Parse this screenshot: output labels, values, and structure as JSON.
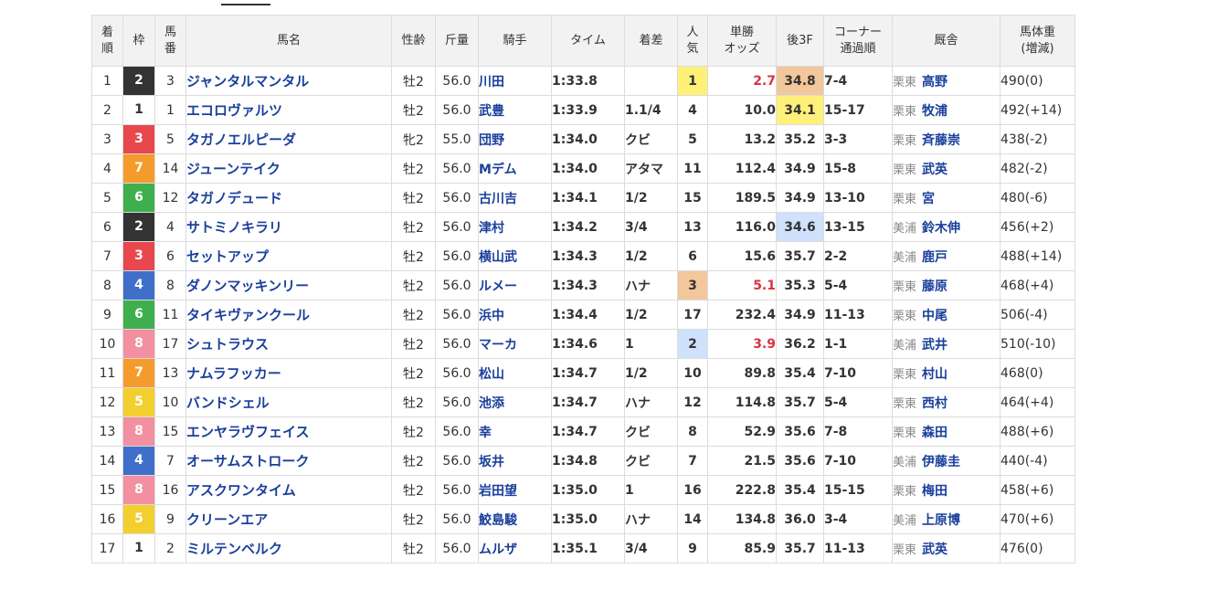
{
  "headers": {
    "rank": "着順",
    "frame": "枠",
    "number": "馬番",
    "horse": "馬名",
    "sexage": "性齢",
    "weight_carried": "斤量",
    "jockey": "騎手",
    "time": "タイム",
    "margin": "着差",
    "popularity": "人気",
    "odds": "単勝オッズ",
    "last3f": "後3F",
    "corner": "コーナー通過順",
    "stable": "厩舎",
    "body_weight": "馬体重(増減)"
  },
  "header_lines": {
    "rank": [
      "着",
      "順"
    ],
    "number": [
      "馬",
      "番"
    ],
    "popularity": [
      "人",
      "気"
    ],
    "odds": [
      "単勝",
      "オッズ"
    ],
    "corner": [
      "コーナー",
      "通過順"
    ],
    "body_weight": [
      "馬体重",
      "(増減)"
    ]
  },
  "frame_colors": {
    "1": {
      "bg": "#ffffff",
      "fg": "#333333"
    },
    "2": {
      "bg": "#333333",
      "fg": "#ffffff"
    },
    "3": {
      "bg": "#e8474e",
      "fg": "#ffffff"
    },
    "4": {
      "bg": "#3f6fc9",
      "fg": "#ffffff"
    },
    "5": {
      "bg": "#f2cf2f",
      "fg": "#ffffff"
    },
    "6": {
      "bg": "#3fae4f",
      "fg": "#ffffff"
    },
    "7": {
      "bg": "#f59b2b",
      "fg": "#ffffff"
    },
    "8": {
      "bg": "#f28fa0",
      "fg": "#ffffff"
    }
  },
  "rows": [
    {
      "rank": "1",
      "frame": "2",
      "number": "3",
      "horse": "ジャンタルマンタル",
      "sexage": "牡2",
      "weight_carried": "56.0",
      "jockey": "川田",
      "time": "1:33.8",
      "margin": "",
      "popularity": "1",
      "odds": "2.7",
      "last3f": "34.8",
      "corner": "7-4",
      "area": "栗東",
      "trainer": "高野",
      "body_weight": "490(0)",
      "pop_hl": "yellow",
      "odds_fav": true,
      "last3f_hl": "orange"
    },
    {
      "rank": "2",
      "frame": "1",
      "number": "1",
      "horse": "エコロヴァルツ",
      "sexage": "牡2",
      "weight_carried": "56.0",
      "jockey": "武豊",
      "time": "1:33.9",
      "margin": "1.1/4",
      "popularity": "4",
      "odds": "10.0",
      "last3f": "34.1",
      "corner": "15-17",
      "area": "栗東",
      "trainer": "牧浦",
      "body_weight": "492(+14)",
      "pop_hl": "",
      "odds_fav": false,
      "last3f_hl": "yellow"
    },
    {
      "rank": "3",
      "frame": "3",
      "number": "5",
      "horse": "タガノエルピーダ",
      "sexage": "牝2",
      "weight_carried": "55.0",
      "jockey": "団野",
      "time": "1:34.0",
      "margin": "クビ",
      "popularity": "5",
      "odds": "13.2",
      "last3f": "35.2",
      "corner": "3-3",
      "area": "栗東",
      "trainer": "斉藤崇",
      "body_weight": "438(-2)",
      "pop_hl": "",
      "odds_fav": false,
      "last3f_hl": ""
    },
    {
      "rank": "4",
      "frame": "7",
      "number": "14",
      "horse": "ジューンテイク",
      "sexage": "牡2",
      "weight_carried": "56.0",
      "jockey": "Mデム",
      "time": "1:34.0",
      "margin": "アタマ",
      "popularity": "11",
      "odds": "112.4",
      "last3f": "34.9",
      "corner": "15-8",
      "area": "栗東",
      "trainer": "武英",
      "body_weight": "482(-2)",
      "pop_hl": "",
      "odds_fav": false,
      "last3f_hl": ""
    },
    {
      "rank": "5",
      "frame": "6",
      "number": "12",
      "horse": "タガノデュード",
      "sexage": "牡2",
      "weight_carried": "56.0",
      "jockey": "古川吉",
      "time": "1:34.1",
      "margin": "1/2",
      "popularity": "15",
      "odds": "189.5",
      "last3f": "34.9",
      "corner": "13-10",
      "area": "栗東",
      "trainer": "宮",
      "body_weight": "480(-6)",
      "pop_hl": "",
      "odds_fav": false,
      "last3f_hl": ""
    },
    {
      "rank": "6",
      "frame": "2",
      "number": "4",
      "horse": "サトミノキラリ",
      "sexage": "牡2",
      "weight_carried": "56.0",
      "jockey": "津村",
      "time": "1:34.2",
      "margin": "3/4",
      "popularity": "13",
      "odds": "116.0",
      "last3f": "34.6",
      "corner": "13-15",
      "area": "美浦",
      "trainer": "鈴木伸",
      "body_weight": "456(+2)",
      "pop_hl": "",
      "odds_fav": false,
      "last3f_hl": "blue"
    },
    {
      "rank": "7",
      "frame": "3",
      "number": "6",
      "horse": "セットアップ",
      "sexage": "牡2",
      "weight_carried": "56.0",
      "jockey": "横山武",
      "time": "1:34.3",
      "margin": "1/2",
      "popularity": "6",
      "odds": "15.6",
      "last3f": "35.7",
      "corner": "2-2",
      "area": "美浦",
      "trainer": "鹿戸",
      "body_weight": "488(+14)",
      "pop_hl": "",
      "odds_fav": false,
      "last3f_hl": ""
    },
    {
      "rank": "8",
      "frame": "4",
      "number": "8",
      "horse": "ダノンマッキンリー",
      "sexage": "牡2",
      "weight_carried": "56.0",
      "jockey": "ルメー",
      "time": "1:34.3",
      "margin": "ハナ",
      "popularity": "3",
      "odds": "5.1",
      "last3f": "35.3",
      "corner": "5-4",
      "area": "栗東",
      "trainer": "藤原",
      "body_weight": "468(+4)",
      "pop_hl": "orange",
      "odds_fav": true,
      "last3f_hl": ""
    },
    {
      "rank": "9",
      "frame": "6",
      "number": "11",
      "horse": "タイキヴァンクール",
      "sexage": "牡2",
      "weight_carried": "56.0",
      "jockey": "浜中",
      "time": "1:34.4",
      "margin": "1/2",
      "popularity": "17",
      "odds": "232.4",
      "last3f": "34.9",
      "corner": "11-13",
      "area": "栗東",
      "trainer": "中尾",
      "body_weight": "506(-4)",
      "pop_hl": "",
      "odds_fav": false,
      "last3f_hl": ""
    },
    {
      "rank": "10",
      "frame": "8",
      "number": "17",
      "horse": "シュトラウス",
      "sexage": "牡2",
      "weight_carried": "56.0",
      "jockey": "マーカ",
      "time": "1:34.6",
      "margin": "1",
      "popularity": "2",
      "odds": "3.9",
      "last3f": "36.2",
      "corner": "1-1",
      "area": "美浦",
      "trainer": "武井",
      "body_weight": "510(-10)",
      "pop_hl": "blue",
      "odds_fav": true,
      "last3f_hl": ""
    },
    {
      "rank": "11",
      "frame": "7",
      "number": "13",
      "horse": "ナムラフッカー",
      "sexage": "牡2",
      "weight_carried": "56.0",
      "jockey": "松山",
      "time": "1:34.7",
      "margin": "1/2",
      "popularity": "10",
      "odds": "89.8",
      "last3f": "35.4",
      "corner": "7-10",
      "area": "栗東",
      "trainer": "村山",
      "body_weight": "468(0)",
      "pop_hl": "",
      "odds_fav": false,
      "last3f_hl": ""
    },
    {
      "rank": "12",
      "frame": "5",
      "number": "10",
      "horse": "バンドシェル",
      "sexage": "牡2",
      "weight_carried": "56.0",
      "jockey": "池添",
      "time": "1:34.7",
      "margin": "ハナ",
      "popularity": "12",
      "odds": "114.8",
      "last3f": "35.7",
      "corner": "5-4",
      "area": "栗東",
      "trainer": "西村",
      "body_weight": "464(+4)",
      "pop_hl": "",
      "odds_fav": false,
      "last3f_hl": ""
    },
    {
      "rank": "13",
      "frame": "8",
      "number": "15",
      "horse": "エンヤラヴフェイス",
      "sexage": "牡2",
      "weight_carried": "56.0",
      "jockey": "幸",
      "time": "1:34.7",
      "margin": "クビ",
      "popularity": "8",
      "odds": "52.9",
      "last3f": "35.6",
      "corner": "7-8",
      "area": "栗東",
      "trainer": "森田",
      "body_weight": "488(+6)",
      "pop_hl": "",
      "odds_fav": false,
      "last3f_hl": ""
    },
    {
      "rank": "14",
      "frame": "4",
      "number": "7",
      "horse": "オーサムストローク",
      "sexage": "牡2",
      "weight_carried": "56.0",
      "jockey": "坂井",
      "time": "1:34.8",
      "margin": "クビ",
      "popularity": "7",
      "odds": "21.5",
      "last3f": "35.6",
      "corner": "7-10",
      "area": "美浦",
      "trainer": "伊藤圭",
      "body_weight": "440(-4)",
      "pop_hl": "",
      "odds_fav": false,
      "last3f_hl": ""
    },
    {
      "rank": "15",
      "frame": "8",
      "number": "16",
      "horse": "アスクワンタイム",
      "sexage": "牡2",
      "weight_carried": "56.0",
      "jockey": "岩田望",
      "time": "1:35.0",
      "margin": "1",
      "popularity": "16",
      "odds": "222.8",
      "last3f": "35.4",
      "corner": "15-15",
      "area": "栗東",
      "trainer": "梅田",
      "body_weight": "458(+6)",
      "pop_hl": "",
      "odds_fav": false,
      "last3f_hl": ""
    },
    {
      "rank": "16",
      "frame": "5",
      "number": "9",
      "horse": "クリーンエア",
      "sexage": "牡2",
      "weight_carried": "56.0",
      "jockey": "鮫島駿",
      "time": "1:35.0",
      "margin": "ハナ",
      "popularity": "14",
      "odds": "134.8",
      "last3f": "36.0",
      "corner": "3-4",
      "area": "美浦",
      "trainer": "上原博",
      "body_weight": "470(+6)",
      "pop_hl": "",
      "odds_fav": false,
      "last3f_hl": ""
    },
    {
      "rank": "17",
      "frame": "1",
      "number": "2",
      "horse": "ミルテンベルク",
      "sexage": "牡2",
      "weight_carried": "56.0",
      "jockey": "ムルザ",
      "time": "1:35.1",
      "margin": "3/4",
      "popularity": "9",
      "odds": "85.9",
      "last3f": "35.7",
      "corner": "11-13",
      "area": "栗東",
      "trainer": "武英",
      "body_weight": "476(0)",
      "pop_hl": "",
      "odds_fav": false,
      "last3f_hl": ""
    }
  ]
}
